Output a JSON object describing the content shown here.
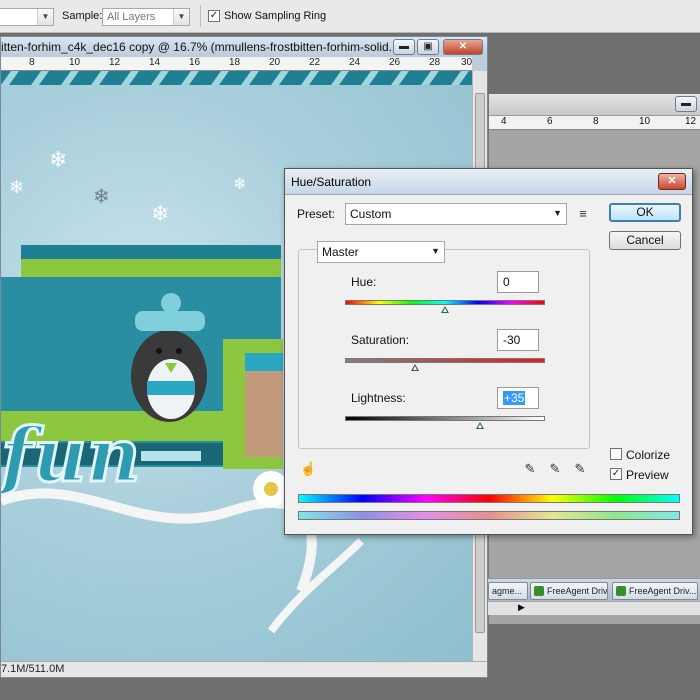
{
  "options_bar": {
    "sample_label": "Sample:",
    "sample_value": "All Layers",
    "show_sampling_ring_label": "Show Sampling Ring",
    "show_sampling_ring_checked": "✓"
  },
  "document": {
    "title": "itten-forhim_c4k_dec16 copy @ 16.7% (mmullens-frostbitten-forhim-solid...",
    "minimize": "▬",
    "restore": "▣",
    "close": "✕",
    "ruler_numbers": [
      "8",
      "10",
      "12",
      "14",
      "16",
      "18",
      "20",
      "22",
      "24",
      "26",
      "28",
      "30"
    ],
    "canvas_word": "fun",
    "status": "7.1M/511.0M"
  },
  "background_window": {
    "ruler_numbers": [
      "4",
      "6",
      "8",
      "10",
      "12"
    ]
  },
  "taskbar": {
    "items": [
      "agme...",
      "FreeAgent Driv...",
      "FreeAgent Driv..."
    ]
  },
  "dialog": {
    "title": "Hue/Saturation",
    "close": "✕",
    "preset_label": "Preset:",
    "preset_value": "Custom",
    "ok": "OK",
    "cancel": "Cancel",
    "channel": "Master",
    "hue_label": "Hue:",
    "hue_value": "0",
    "saturation_label": "Saturation:",
    "saturation_value": "-30",
    "lightness_label": "Lightness:",
    "lightness_value": "+35",
    "colorize_label": "Colorize",
    "preview_label": "Preview",
    "preview_checked": "✓",
    "colorize_checked": ""
  },
  "colors": {
    "accent": "#3399ff",
    "dialog_bg": "#f0f0f0",
    "scrapbook_teal": "#1f7f93",
    "scrapbook_green": "#8dc63f"
  }
}
